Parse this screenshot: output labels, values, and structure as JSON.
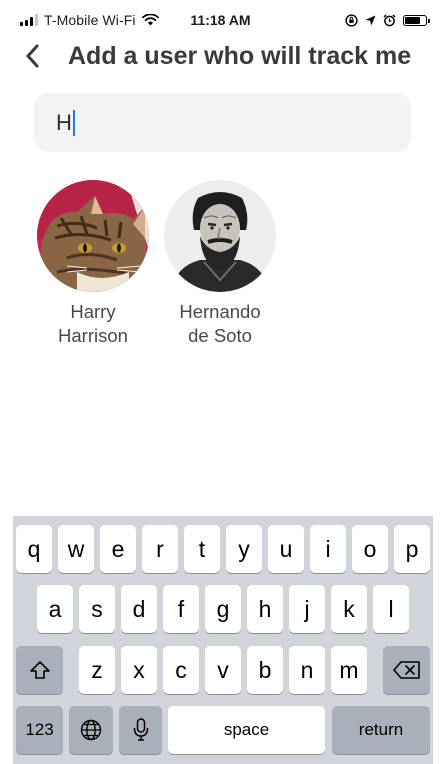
{
  "status_bar": {
    "carrier": "T-Mobile Wi-Fi",
    "time": "11:18 AM",
    "signal_bars_filled": 3,
    "signal_bars_total": 4,
    "battery_level": 0.8,
    "icons": [
      "wifi-icon",
      "screen-lock-icon",
      "location-arrow-icon",
      "alarm-icon",
      "battery-icon"
    ]
  },
  "header": {
    "back_icon": "chevron-left-icon",
    "title": "Add a user who will track me"
  },
  "search": {
    "value": "H",
    "accent": "#1e7cf2"
  },
  "results": [
    {
      "first": "Harry",
      "last": "Harrison",
      "avatar": "cat-photo"
    },
    {
      "first": "Hernando",
      "last": "de Soto",
      "avatar": "portrait-engraving"
    }
  ],
  "keyboard": {
    "row1": [
      "q",
      "w",
      "e",
      "r",
      "t",
      "y",
      "u",
      "i",
      "o",
      "p"
    ],
    "row2": [
      "a",
      "s",
      "d",
      "f",
      "g",
      "h",
      "j",
      "k",
      "l"
    ],
    "row3": [
      "z",
      "x",
      "c",
      "v",
      "b",
      "n",
      "m"
    ],
    "numbers_label": "123",
    "space_label": "space",
    "return_label": "return",
    "shift_icon": "shift-icon",
    "delete_icon": "delete-icon",
    "globe_icon": "globe-icon",
    "mic_icon": "microphone-icon"
  }
}
